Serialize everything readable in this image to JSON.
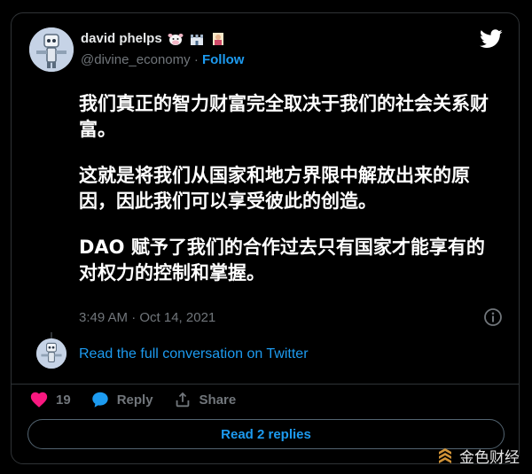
{
  "author": {
    "display_name": "david phelps",
    "handle": "@divine_economy",
    "separator": "·",
    "follow_label": "Follow",
    "emojis": [
      "cow-face-emoji",
      "castle-emoji",
      "person-emoji"
    ]
  },
  "tweet": {
    "paragraphs": [
      "我们真正的智力财富完全取决于我们的社会关系财富。",
      "这就是将我们从国家和地方界限中解放出来的原因，因此我们可以享受彼此的创造。",
      "DAO  赋予了我们的合作过去只有国家才能享有的对权力的控制和掌握。"
    ],
    "timestamp": "3:49 AM · Oct 14, 2021"
  },
  "conversation_link": "Read the full conversation on Twitter",
  "actions": {
    "like_count": "19",
    "reply_label": "Reply",
    "share_label": "Share"
  },
  "read_replies_label": "Read 2 replies",
  "watermark": "金色财经",
  "colors": {
    "accent": "#1d9bf0",
    "like": "#f91880",
    "muted": "#71767b",
    "border": "#2f3336"
  },
  "icons": [
    "twitter-bird-icon",
    "info-icon",
    "heart-icon",
    "reply-bubble-icon",
    "share-icon",
    "jinse-logo-icon"
  ]
}
